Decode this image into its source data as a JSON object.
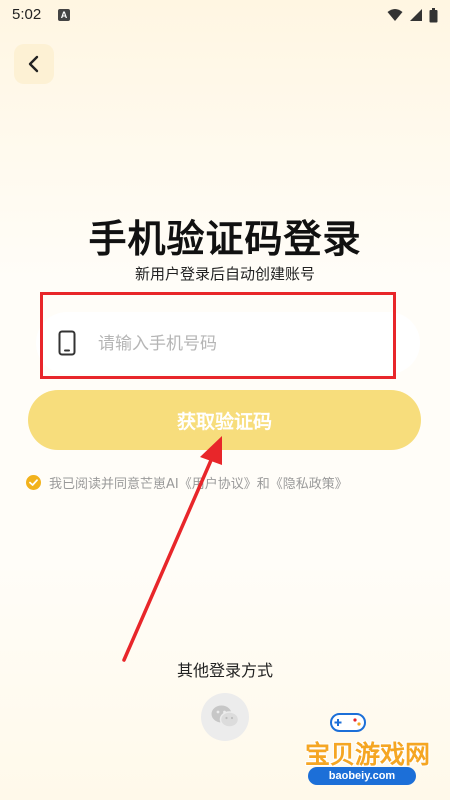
{
  "status_bar": {
    "time": "5:02",
    "app_icon_letter": "A"
  },
  "header": {
    "back_icon": "chevron-left-icon"
  },
  "main": {
    "title": "手机验证码登录",
    "subtitle": "新用户登录后自动创建账号",
    "phone_field": {
      "placeholder": "请输入手机号码",
      "value": "",
      "icon": "phone-icon"
    },
    "get_code_button_label": "获取验证码",
    "agreement": {
      "prefix": "我已阅读并同意芒崽AI",
      "user_agreement": "《用户协议》",
      "conjunction": "和",
      "privacy_policy": "《隐私政策》",
      "checked": true
    }
  },
  "other_login": {
    "label": "其他登录方式",
    "wechat_icon": "wechat-icon"
  },
  "watermark": {
    "text": "宝贝游戏网",
    "url": "baobeiy.com"
  },
  "colors": {
    "accent": "#f7dd7c",
    "check": "#f2b21c",
    "annotation": "#e8262a",
    "watermark_orange": "#f5a623",
    "watermark_blue": "#1c6fd8"
  }
}
